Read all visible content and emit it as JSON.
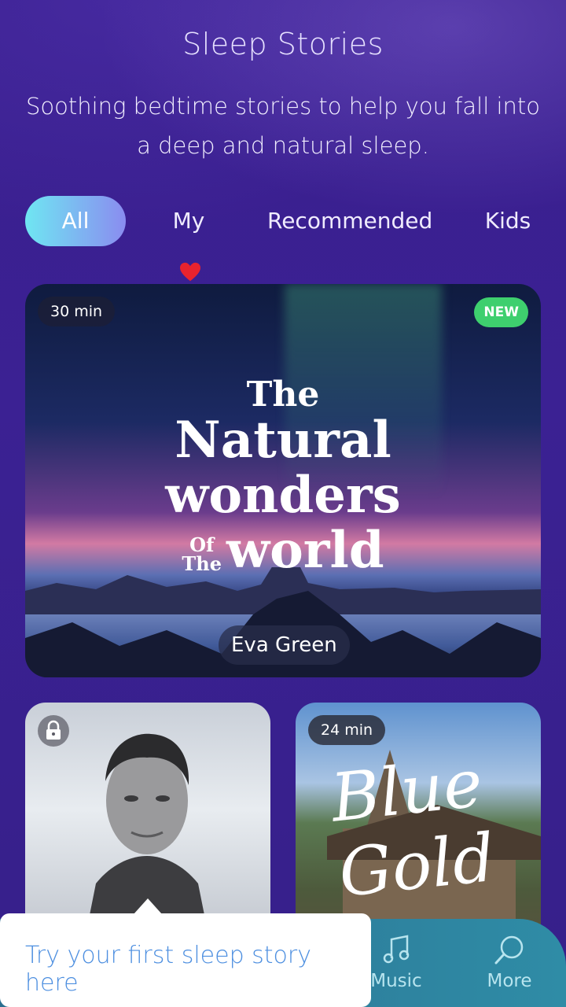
{
  "header": {
    "title": "Sleep Stories",
    "subtitle": "Soothing bedtime stories to help you fall into a deep and natural sleep."
  },
  "tabs": [
    {
      "label": "All",
      "active": true
    },
    {
      "label": "My",
      "icon": "heart-icon",
      "active": false
    },
    {
      "label": "Recommended",
      "active": false
    },
    {
      "label": "Kids",
      "active": false
    }
  ],
  "featured": {
    "duration": "30 min",
    "badge": "NEW",
    "title_line1": "The",
    "title_line2": "Natural",
    "title_line3": "wonders",
    "title_of": "Of",
    "title_the": "The",
    "title_world": "world",
    "narrator": "Eva Green"
  },
  "stories": [
    {
      "locked": true,
      "icon": "lock-icon"
    },
    {
      "duration": "24 min",
      "title_line1": "Blue",
      "title_line2": "Gold"
    }
  ],
  "bottom_nav": [
    {
      "label": "Music",
      "icon": "music-note-icon"
    },
    {
      "label": "More",
      "icon": "search-icon"
    }
  ],
  "tooltip": {
    "text": "Try your first sleep story here"
  },
  "colors": {
    "background": "#3a1f8e",
    "tab_active_start": "#6fe6f2",
    "tab_active_end": "#8a8cf0",
    "new_badge": "#3ecf6e",
    "tooltip_text": "#4d8fe0",
    "nav_bg": "#2f8ca6"
  }
}
